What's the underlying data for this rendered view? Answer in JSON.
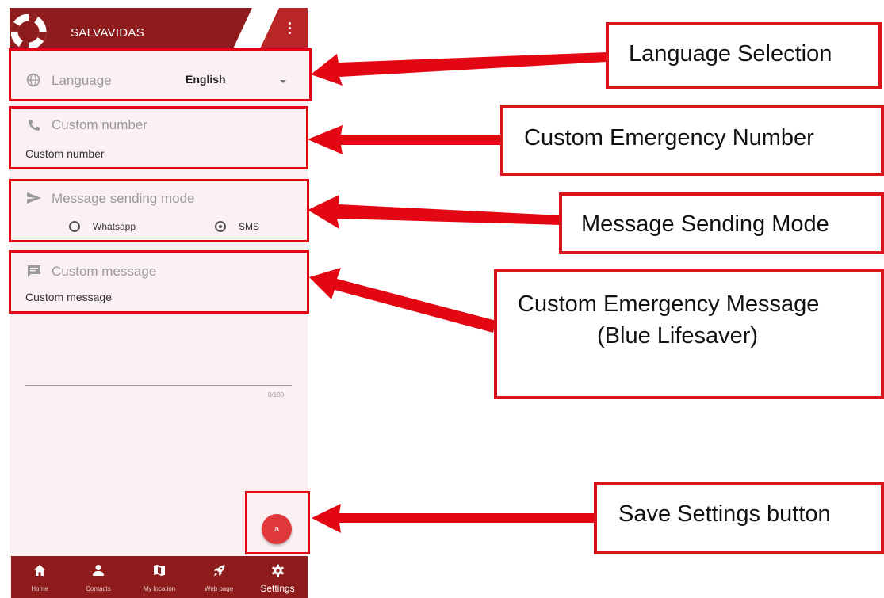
{
  "app": {
    "title": "SALVAVIDAS"
  },
  "settings": {
    "language": {
      "label": "Language",
      "selected": "English",
      "icon": "globe-icon"
    },
    "custom_number": {
      "label": "Custom number",
      "value": "Custom number",
      "icon": "phone-icon"
    },
    "sending_mode": {
      "label": "Message sending mode",
      "icon": "send-icon",
      "options": [
        {
          "label": "Whatsapp",
          "selected": false
        },
        {
          "label": "SMS",
          "selected": true
        }
      ]
    },
    "custom_message": {
      "label": "Custom message",
      "value": "Custom message",
      "icon": "chat-icon",
      "counter": "0/100"
    }
  },
  "fab": {
    "label": "a"
  },
  "bottom_nav": [
    {
      "label": "Home",
      "icon": "home-icon"
    },
    {
      "label": "Contacts",
      "icon": "person-icon"
    },
    {
      "label": "My location",
      "icon": "map-icon"
    },
    {
      "label": "Web page",
      "icon": "rocket-icon"
    },
    {
      "label": "Settings",
      "icon": "gear-icon",
      "active": true
    }
  ],
  "annotations": {
    "language": "Language Selection",
    "number": "Custom Emergency Number",
    "mode": "Message Sending Mode",
    "message_line1": "Custom Emergency Message",
    "message_line2": "(Blue Lifesaver)",
    "save": "Save Settings button"
  },
  "colors": {
    "appbar": "#8e1c1c",
    "highlight": "#e30613",
    "fab": "#e0373a",
    "screen_bg": "#fcf1f2"
  }
}
